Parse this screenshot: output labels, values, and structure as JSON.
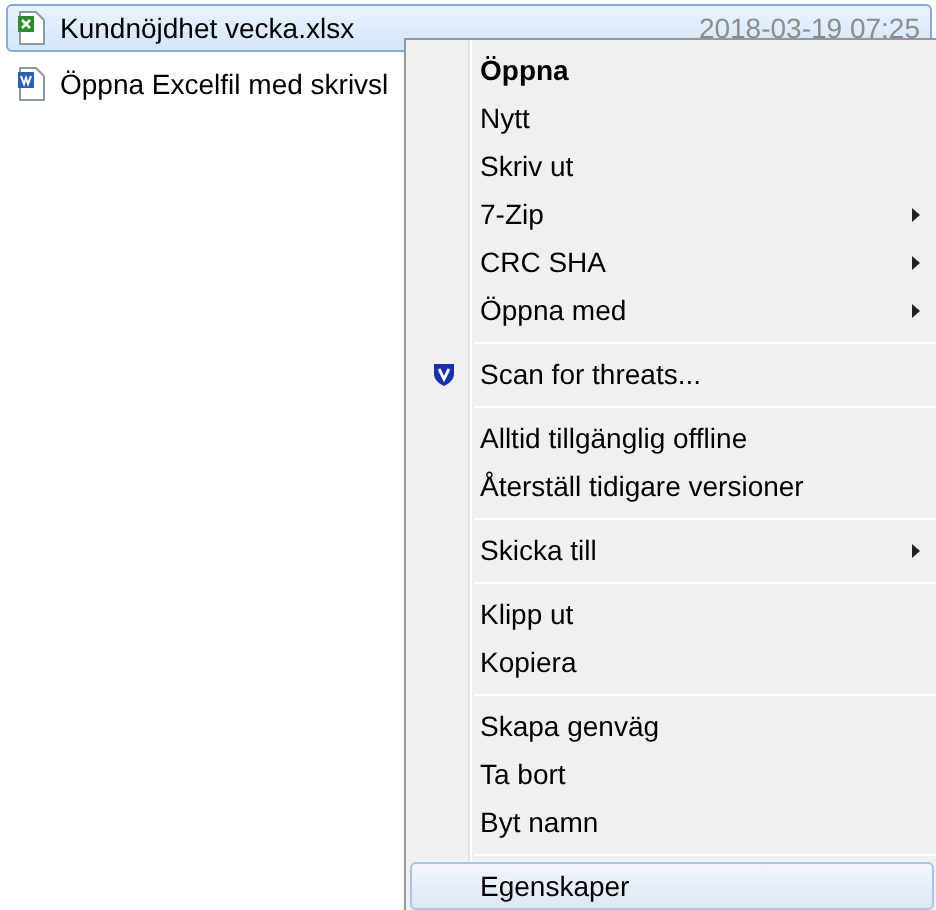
{
  "files": [
    {
      "name": "Kundnöjdhet vecka.xlsx",
      "date": "2018-03-19 07:25",
      "kind": "excel",
      "selected": true
    },
    {
      "name": "Öppna Excelfil med skrivsl",
      "kind": "word",
      "selected": false
    }
  ],
  "context_menu": {
    "items": [
      {
        "kind": "item",
        "label": "Öppna",
        "bold": true,
        "submenu": false,
        "selected": false
      },
      {
        "kind": "item",
        "label": "Nytt",
        "bold": false,
        "submenu": false,
        "selected": false
      },
      {
        "kind": "item",
        "label": "Skriv ut",
        "bold": false,
        "submenu": false,
        "selected": false
      },
      {
        "kind": "item",
        "label": "7-Zip",
        "bold": false,
        "submenu": true,
        "selected": false
      },
      {
        "kind": "item",
        "label": "CRC SHA",
        "bold": false,
        "submenu": true,
        "selected": false
      },
      {
        "kind": "item",
        "label": "Öppna med",
        "bold": false,
        "submenu": true,
        "selected": false
      },
      {
        "kind": "separator"
      },
      {
        "kind": "shield_item",
        "label": "Scan for threats...",
        "bold": false,
        "submenu": false,
        "selected": false
      },
      {
        "kind": "separator"
      },
      {
        "kind": "item",
        "label": "Alltid tillgänglig offline",
        "bold": false,
        "submenu": false,
        "selected": false
      },
      {
        "kind": "item",
        "label": "Återställ tidigare versioner",
        "bold": false,
        "submenu": false,
        "selected": false
      },
      {
        "kind": "separator"
      },
      {
        "kind": "item",
        "label": "Skicka till",
        "bold": false,
        "submenu": true,
        "selected": false
      },
      {
        "kind": "separator"
      },
      {
        "kind": "item",
        "label": "Klipp ut",
        "bold": false,
        "submenu": false,
        "selected": false
      },
      {
        "kind": "item",
        "label": "Kopiera",
        "bold": false,
        "submenu": false,
        "selected": false
      },
      {
        "kind": "separator"
      },
      {
        "kind": "item",
        "label": "Skapa genväg",
        "bold": false,
        "submenu": false,
        "selected": false
      },
      {
        "kind": "item",
        "label": "Ta bort",
        "bold": false,
        "submenu": false,
        "selected": false
      },
      {
        "kind": "item",
        "label": "Byt namn",
        "bold": false,
        "submenu": false,
        "selected": false
      },
      {
        "kind": "separator"
      },
      {
        "kind": "item",
        "label": "Egenskaper",
        "bold": false,
        "submenu": false,
        "selected": true
      }
    ]
  }
}
